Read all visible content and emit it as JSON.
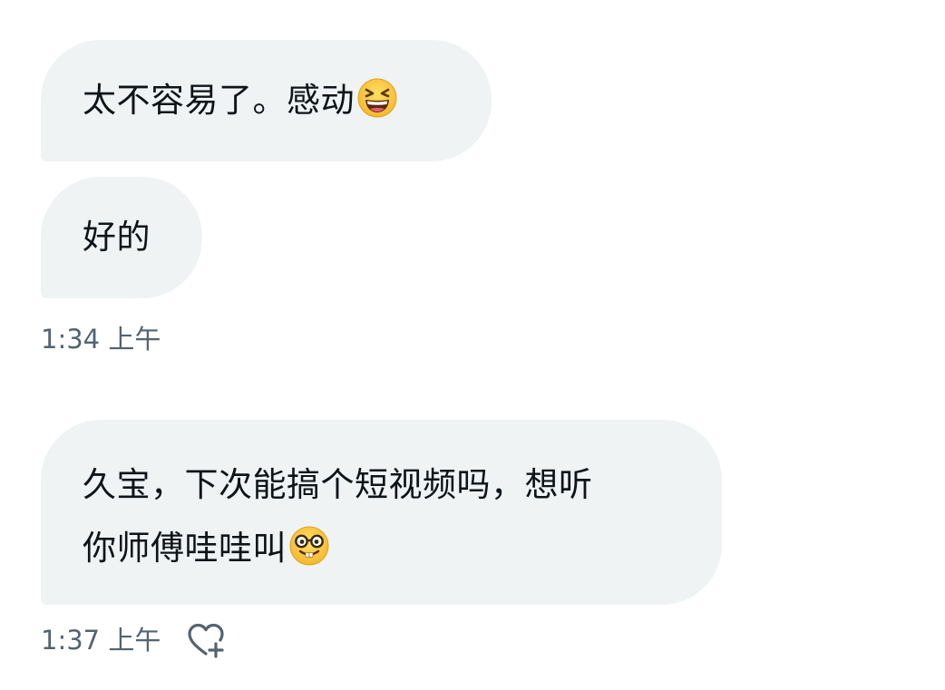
{
  "messages": [
    {
      "text": "太不容易了。感动",
      "emoji": "grinning-squinting-face"
    },
    {
      "text": "好的",
      "emoji": ""
    },
    {
      "line1": "久宝，下次能搞个短视频吗，想听",
      "line2": "你师傅哇哇叫",
      "emoji": "nerd-face"
    }
  ],
  "timestamps": {
    "first": "1:34 上午",
    "second": "1:37 上午"
  },
  "colors": {
    "bubble_bg": "#eff3f4",
    "text": "#0f1419",
    "meta_text": "#536471",
    "emoji_yellow": "#f9c836"
  },
  "icons": {
    "reaction": "add-reaction-heart-icon"
  }
}
